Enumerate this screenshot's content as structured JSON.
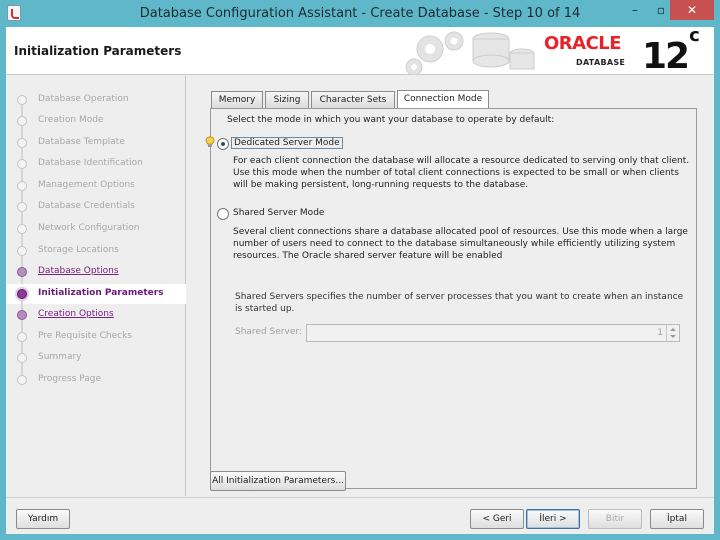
{
  "window": {
    "title": "Database Configuration Assistant - Create Database - Step 10 of 14",
    "min_glyph": "–",
    "max_glyph": "▫",
    "close_glyph": "✕"
  },
  "header": {
    "page_title": "Initialization Parameters",
    "logo_text": "ORACLE",
    "logo_sub": "DATABASE",
    "version": "12",
    "version_sup": "c",
    "logo_color": "#e52329"
  },
  "steps": [
    {
      "label": "Database Operation",
      "state": "done"
    },
    {
      "label": "Creation Mode",
      "state": "done"
    },
    {
      "label": "Database Template",
      "state": "done"
    },
    {
      "label": "Database Identification",
      "state": "done"
    },
    {
      "label": "Management Options",
      "state": "done"
    },
    {
      "label": "Database Credentials",
      "state": "done"
    },
    {
      "label": "Network Configuration",
      "state": "done"
    },
    {
      "label": "Storage Locations",
      "state": "done"
    },
    {
      "label": "Database Options",
      "state": "link"
    },
    {
      "label": "Initialization Parameters",
      "state": "current"
    },
    {
      "label": "Creation Options",
      "state": "link"
    },
    {
      "label": "Pre Requisite Checks",
      "state": "pending"
    },
    {
      "label": "Summary",
      "state": "pending"
    },
    {
      "label": "Progress Page",
      "state": "pending"
    }
  ],
  "tabs": [
    {
      "label": "Memory"
    },
    {
      "label": "Sizing"
    },
    {
      "label": "Character Sets"
    },
    {
      "label": "Connection Mode",
      "active": true
    }
  ],
  "connection": {
    "instruction": "Select the mode in which you want your database to operate by default:",
    "dedicated_label": "Dedicated Server Mode",
    "dedicated_desc": "For each client connection the database will allocate a resource dedicated to serving only that client. Use this mode when the number of total client connections is expected to be small or when clients will be making persistent, long-running requests to the database.",
    "shared_label": "Shared Server Mode",
    "shared_desc": "Several client connections share a database allocated pool of resources. Use this mode when a large number of users need to connect to the database simultaneously while efficiently utilizing system resources. The Oracle shared server feature will be enabled",
    "shared_servers_desc": "Shared Servers specifies the number of server processes that you want to create when an instance is started up.",
    "shared_server_label": "Shared Server:",
    "shared_server_value": "1",
    "selected": "dedicated"
  },
  "buttons": {
    "all_params": "All Initialization Parameters...",
    "help": "Yardım",
    "back": "< Geri",
    "next": "İleri >",
    "finish": "Bitir",
    "cancel": "İptal"
  }
}
